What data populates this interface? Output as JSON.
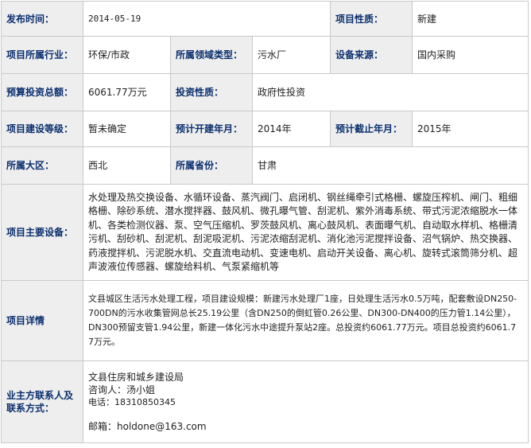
{
  "labels": {
    "publish_time": "发布时间：",
    "project_nature": "项目性质：",
    "industry": "项目所属行业：",
    "domain_type": "所属领域类型：",
    "equip_source": "设备来源：",
    "budget": "预算投资总额：",
    "invest_nature": "投资性质：",
    "level": "项目建设等级：",
    "start_date": "预计开建年月：",
    "end_date": "预计截止年月：",
    "region": "所属大区：",
    "province": "所属省份：",
    "equipment": "项目主要设备：",
    "details": "项目详情",
    "contact": "业主方联系人及联系方式："
  },
  "values": {
    "publish_time": "2014-05-19",
    "project_nature": "新建",
    "industry": "环保/市政",
    "domain_type": "污水厂",
    "equip_source": "国内采购",
    "budget": "6061.77万元",
    "invest_nature": "政府性投资",
    "level": "暂未确定",
    "start_date": "2014年",
    "end_date": "2015年",
    "region": "西北",
    "province": "甘肃",
    "equipment": "水处理及热交换设备、水循环设备、蒸汽阀门、启闭机、钢丝绳牵引式格栅、螺旋压榨机、闸门、粗细格栅、除砂系统、潜水搅拌器、鼓风机、微孔曝气管、刮泥机、紫外消毒系统、带式污泥浓缩脱水一体机、各类检测仪器、泵、空气压缩机、罗茨鼓风机、离心鼓风机、表面曝气机、自动取水样机、格栅清污机、刮砂机、刮泥机、刮泥吸泥机、污泥浓缩刮泥机、消化池污泥搅拌设备、沼气锅炉、热交换器、药液搅拌机、污泥脱水机、交直流电动机、变速电机、启动开关设备、离心机、旋转式滚筒筛分机、超声波液位传感器、螺旋给料机、气泵紧缩机等",
    "details": "文县城区生活污水处理工程，项目建设规模：新建污水处理厂1座，日处理生活污水0.5万吨，配套敷设DN250-700DN的污水收集管网总长25.19公里（含DN250的倒虹管0.26公里、DN300-DN400的压力管1.14公里），DN300预留支管1.94公里，新建一体化污水中途提升泵站2座。总投资约6061.77万元。项目总投资约6061.77万元。",
    "contact": {
      "org": "文县住房和城乡建设局",
      "person": "咨询人：汤小姐",
      "phone": "电话：18310850345",
      "email": "邮箱：holdone@163.com"
    }
  }
}
